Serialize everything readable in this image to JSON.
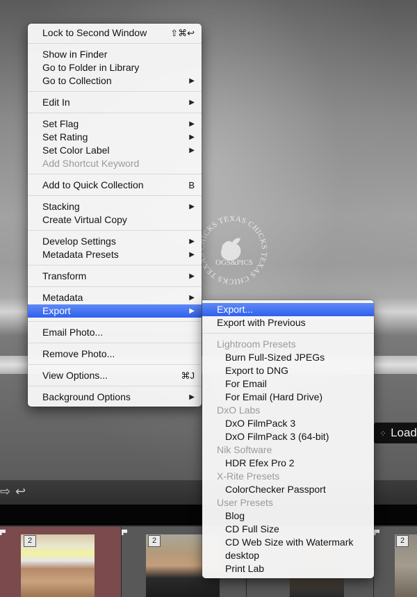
{
  "context_menu": {
    "items": [
      {
        "label": "Lock to Second Window",
        "shortcut": "⇧⌘↩"
      },
      {
        "label": "Show in Finder"
      },
      {
        "label": "Go to Folder in Library"
      },
      {
        "label": "Go to Collection"
      },
      {
        "label": "Edit In"
      },
      {
        "label": "Set Flag"
      },
      {
        "label": "Set Rating"
      },
      {
        "label": "Set Color Label"
      },
      {
        "label": "Add Shortcut Keyword"
      },
      {
        "label": "Add to Quick Collection",
        "shortcut": "B"
      },
      {
        "label": "Stacking"
      },
      {
        "label": "Create Virtual Copy"
      },
      {
        "label": "Develop Settings"
      },
      {
        "label": "Metadata Presets"
      },
      {
        "label": "Transform"
      },
      {
        "label": "Metadata"
      },
      {
        "label": "Export"
      },
      {
        "label": "Email Photo..."
      },
      {
        "label": "Remove Photo..."
      },
      {
        "label": "View Options...",
        "shortcut": "⌘J"
      },
      {
        "label": "Background Options"
      }
    ]
  },
  "export_submenu": {
    "export": "Export...",
    "export_with_previous": "Export with Previous",
    "lightroom_presets": {
      "heading": "Lightroom Presets",
      "items": [
        "Burn Full-Sized JPEGs",
        "Export to DNG",
        "For Email",
        "For Email (Hard Drive)"
      ]
    },
    "dxo_labs": {
      "heading": "DxO Labs",
      "items": [
        "DxO FilmPack 3",
        "DxO FilmPack 3 (64-bit)"
      ]
    },
    "nik_software": {
      "heading": "Nik Software",
      "items": [
        "HDR Efex Pro 2"
      ]
    },
    "xrite_presets": {
      "heading": "X-Rite Presets",
      "items": [
        "ColorChecker Passport"
      ]
    },
    "user_presets": {
      "heading": "User Presets",
      "items": [
        "Blog",
        "CD Full Size",
        "CD Web Size with Watermark",
        "desktop",
        "Print Lab"
      ]
    }
  },
  "watermark": {
    "text": "CHICKS TEXAS CHICKS TEXAS CHICKS TEXAS",
    "center": "OGS&PICS"
  },
  "load_badge": {
    "label": "Load"
  },
  "filmstrip": {
    "stack_counts": [
      "2",
      "2",
      "2"
    ]
  },
  "colors": {
    "highlight": "#3b6cf0",
    "menu_bg": "#f6f6f6",
    "disabled": "#9a9a9a"
  }
}
